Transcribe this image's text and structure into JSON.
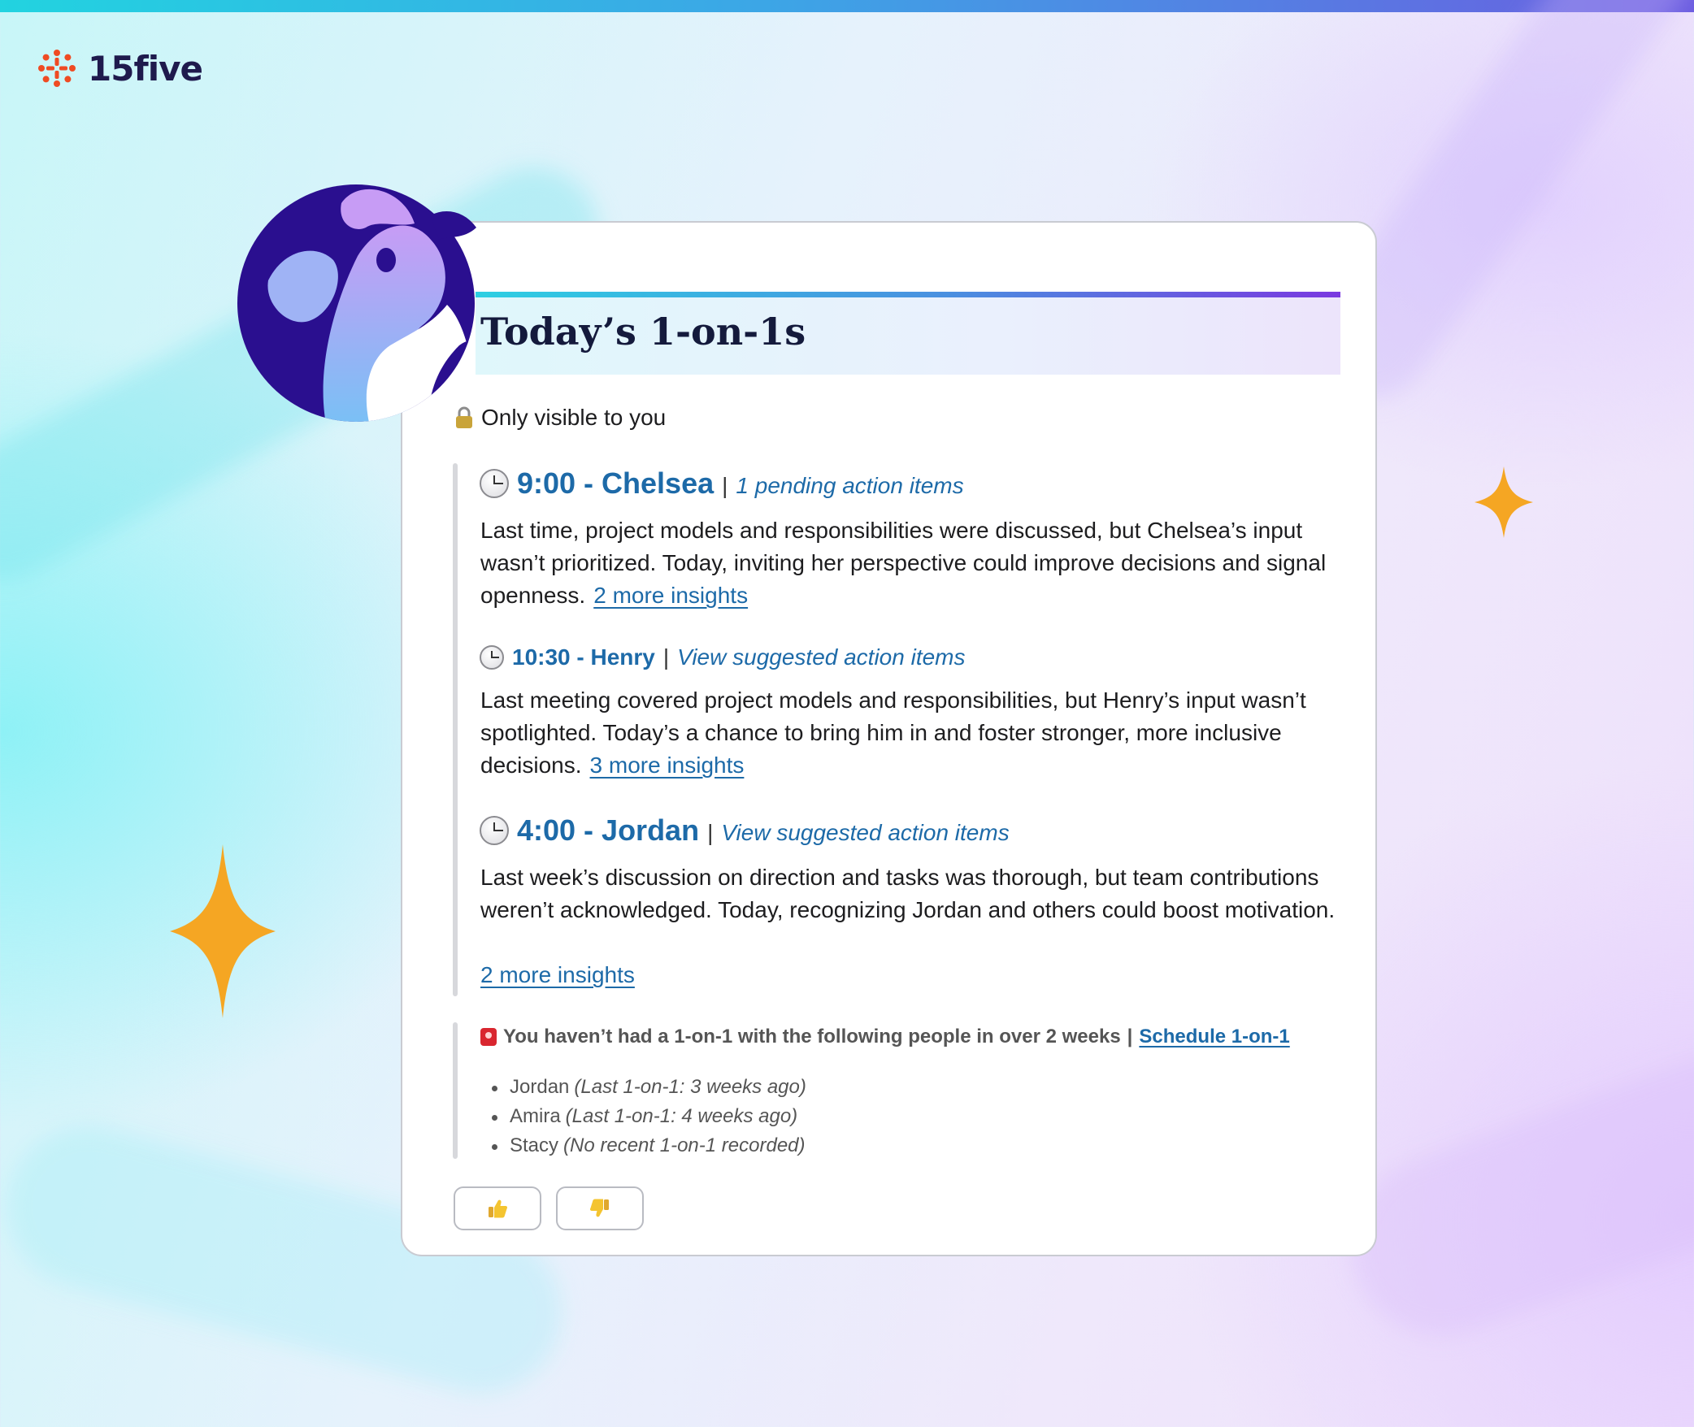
{
  "brand": {
    "name": "15five",
    "accent": "#ef4b23"
  },
  "card": {
    "title": "Today’s 1-on-1s",
    "visibility_note": "Only visible to you",
    "visibility_icon": "lock-icon"
  },
  "meetings": [
    {
      "title": "9:00 - Chelsea",
      "action_link": "1 pending action items",
      "summary": "Last time, project models and responsibilities were discussed, but Chelsea’s input wasn’t prioritized. Today, inviting her perspective could improve decisions and signal openness.",
      "more_link": "2 more insights",
      "icon": "clock-icon"
    },
    {
      "title": "10:30 - Henry",
      "action_link": "View suggested action items",
      "summary": "Last meeting covered project models and responsibilities, but Henry’s input wasn’t spotlighted. Today’s a chance to bring him in and foster stronger, more inclusive decisions.",
      "more_link": "3 more insights",
      "icon": "clock-icon"
    },
    {
      "title": "4:00 - Jordan",
      "action_link": "View suggested action items",
      "summary": "Last week’s discussion on direction and tasks was thorough, but team contributions weren’t acknowledged. Today, recognizing Jordan and others could boost motivation.",
      "more_link": "2 more insights",
      "icon": "clock-icon"
    }
  ],
  "overdue": {
    "message": "You haven’t had a 1-on-1 with the following people in over 2 weeks",
    "separator": "|",
    "schedule_link": "Schedule 1-on-1",
    "icon": "siren-icon",
    "people": [
      {
        "name": "Jordan",
        "note": "(Last 1-on-1: 3 weeks ago)"
      },
      {
        "name": "Amira",
        "note": "(Last 1-on-1: 4 weeks ago)"
      },
      {
        "name": "Stacy",
        "note": "(No recent 1-on-1 recorded)"
      }
    ]
  },
  "feedback": {
    "thumbs_up_icon": "thumbs-up-icon",
    "thumbs_down_icon": "thumbs-down-icon"
  },
  "colors": {
    "link": "#1d6aa8",
    "title": "#141a3c",
    "sparkle": "#f5a623"
  }
}
